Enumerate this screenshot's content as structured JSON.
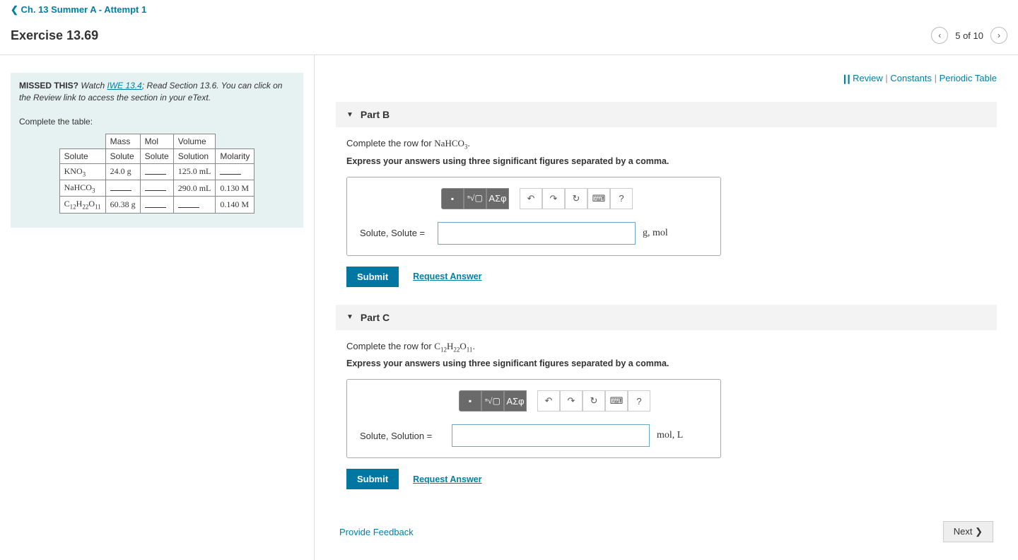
{
  "nav": {
    "back_label": "Ch. 13 Summer A - Attempt 1"
  },
  "header": {
    "title": "Exercise 13.69",
    "pager_text": "5 of 10"
  },
  "hint": {
    "missed_label": "MISSED THIS?",
    "watch_label": "Watch",
    "iwe_label": "IWE 13.4",
    "rest_text": "; Read Section 13.6. You can click on the Review link to access the section in your eText.",
    "complete_label": "Complete the table:"
  },
  "table": {
    "headers": {
      "mass": "Mass",
      "mol": "Mol",
      "volume": "Volume"
    },
    "sub_headers": {
      "col1": "Solute",
      "solute1": "Solute",
      "solute2": "Solute",
      "solution": "Solution",
      "molarity": "Molarity"
    },
    "rows": [
      {
        "formula_html": "KNO<sub class='chem-sub'>3</sub>",
        "mass": "24.0 g",
        "mol": "",
        "volume": "125.0 mL",
        "molarity": ""
      },
      {
        "formula_html": "NaHCO<sub class='chem-sub'>3</sub>",
        "mass": "",
        "mol": "",
        "volume": "290.0 mL",
        "molarity": "0.130 M"
      },
      {
        "formula_html": "C<sub class='chem-sub'>12</sub>H<sub class='chem-sub'>22</sub>O<sub class='chem-sub'>11</sub>",
        "mass": "60.38 g",
        "mol": "",
        "volume": "",
        "molarity": "0.140 M"
      }
    ]
  },
  "toplinks": {
    "review": "Review",
    "constants": "Constants",
    "periodic": "Periodic Table"
  },
  "parts": {
    "b": {
      "title": "Part B",
      "prompt_prefix": "Complete the row for ",
      "prompt_formula_html": "NaHCO<sub class='chem-sub'>3</sub>",
      "prompt_suffix": ".",
      "instruction": "Express your answers using three significant figures separated by a comma.",
      "answer_label": "Solute, Solute =",
      "units": "g, mol",
      "submit": "Submit",
      "request": "Request Answer"
    },
    "c": {
      "title": "Part C",
      "prompt_prefix": "Complete the row for ",
      "prompt_formula_html": "C<sub class='chem-sub'>12</sub>H<sub class='chem-sub'>22</sub>O<sub class='chem-sub'>11</sub>",
      "prompt_suffix": ".",
      "instruction": "Express your answers using three significant figures separated by a comma.",
      "answer_label": "Solute, Solution =",
      "units": "mol, L",
      "submit": "Submit",
      "request": "Request Answer"
    }
  },
  "toolbar": {
    "greek": "ΑΣφ"
  },
  "footer": {
    "feedback": "Provide Feedback",
    "next": "Next"
  }
}
